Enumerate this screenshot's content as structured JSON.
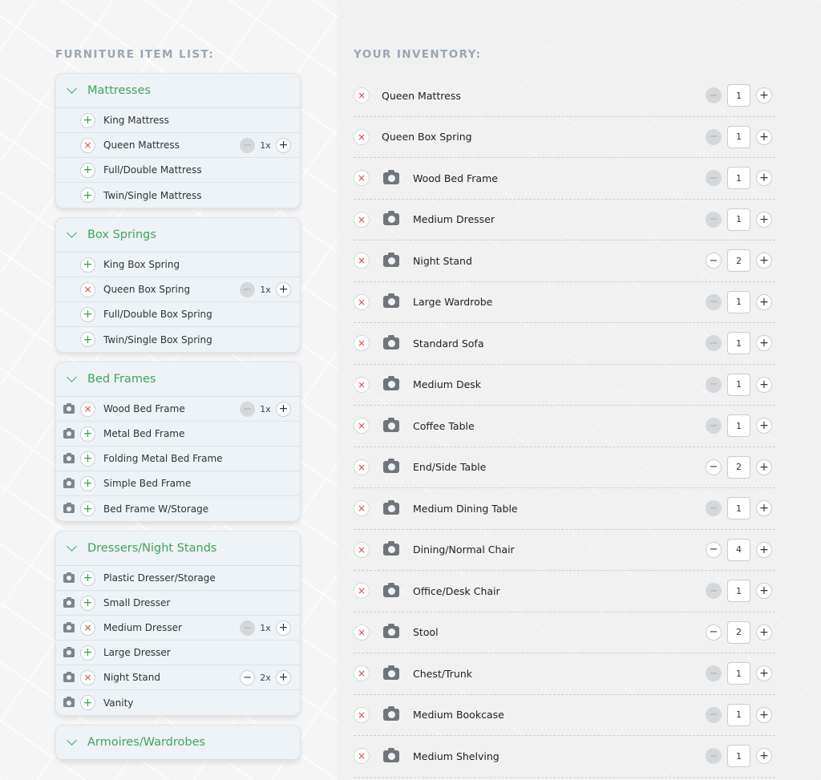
{
  "furniture_list": {
    "title": "FURNITURE ITEM LIST:",
    "categories": [
      {
        "name": "Mattresses",
        "items": [
          {
            "label": "King Mattress",
            "camera": false,
            "added": false
          },
          {
            "label": "Queen Mattress",
            "camera": false,
            "added": true,
            "qty": "1x",
            "minus_active": false
          },
          {
            "label": "Full/Double Mattress",
            "camera": false,
            "added": false
          },
          {
            "label": "Twin/Single Mattress",
            "camera": false,
            "added": false
          }
        ]
      },
      {
        "name": "Box Springs",
        "items": [
          {
            "label": "King Box Spring",
            "camera": false,
            "added": false
          },
          {
            "label": "Queen Box Spring",
            "camera": false,
            "added": true,
            "qty": "1x",
            "minus_active": false
          },
          {
            "label": "Full/Double Box Spring",
            "camera": false,
            "added": false
          },
          {
            "label": "Twin/Single Box Spring",
            "camera": false,
            "added": false
          }
        ]
      },
      {
        "name": "Bed Frames",
        "items": [
          {
            "label": "Wood Bed Frame",
            "camera": true,
            "added": true,
            "qty": "1x",
            "minus_active": false
          },
          {
            "label": "Metal Bed Frame",
            "camera": true,
            "added": false
          },
          {
            "label": "Folding Metal Bed Frame",
            "camera": true,
            "added": false
          },
          {
            "label": "Simple Bed Frame",
            "camera": true,
            "added": false
          },
          {
            "label": "Bed Frame W/Storage",
            "camera": true,
            "added": false
          }
        ]
      },
      {
        "name": "Dressers/Night Stands",
        "items": [
          {
            "label": "Plastic Dresser/Storage",
            "camera": true,
            "added": false
          },
          {
            "label": "Small Dresser",
            "camera": true,
            "added": false
          },
          {
            "label": "Medium Dresser",
            "camera": true,
            "added": true,
            "qty": "1x",
            "minus_active": false
          },
          {
            "label": "Large Dresser",
            "camera": true,
            "added": false
          },
          {
            "label": "Night Stand",
            "camera": true,
            "added": true,
            "qty": "2x",
            "minus_active": true
          },
          {
            "label": "Vanity",
            "camera": true,
            "added": false
          }
        ]
      },
      {
        "name": "Armoires/Wardrobes",
        "items": []
      }
    ]
  },
  "inventory": {
    "title": "YOUR INVENTORY:",
    "items": [
      {
        "label": "Queen Mattress",
        "camera": false,
        "qty": "1",
        "minus_active": false
      },
      {
        "label": "Queen Box Spring",
        "camera": false,
        "qty": "1",
        "minus_active": false
      },
      {
        "label": "Wood Bed Frame",
        "camera": true,
        "qty": "1",
        "minus_active": false
      },
      {
        "label": "Medium Dresser",
        "camera": true,
        "qty": "1",
        "minus_active": false
      },
      {
        "label": "Night Stand",
        "camera": true,
        "qty": "2",
        "minus_active": true
      },
      {
        "label": "Large Wardrobe",
        "camera": true,
        "qty": "1",
        "minus_active": false
      },
      {
        "label": "Standard Sofa",
        "camera": true,
        "qty": "1",
        "minus_active": false
      },
      {
        "label": "Medium Desk",
        "camera": true,
        "qty": "1",
        "minus_active": false
      },
      {
        "label": "Coffee Table",
        "camera": true,
        "qty": "1",
        "minus_active": false
      },
      {
        "label": "End/Side Table",
        "camera": true,
        "qty": "2",
        "minus_active": true
      },
      {
        "label": "Medium Dining Table",
        "camera": true,
        "qty": "1",
        "minus_active": false
      },
      {
        "label": "Dining/Normal Chair",
        "camera": true,
        "qty": "4",
        "minus_active": true
      },
      {
        "label": "Office/Desk Chair",
        "camera": true,
        "qty": "1",
        "minus_active": false
      },
      {
        "label": "Stool",
        "camera": true,
        "qty": "2",
        "minus_active": true
      },
      {
        "label": "Chest/Trunk",
        "camera": true,
        "qty": "1",
        "minus_active": false
      },
      {
        "label": "Medium Bookcase",
        "camera": true,
        "qty": "1",
        "minus_active": false
      },
      {
        "label": "Medium Shelving",
        "camera": true,
        "qty": "1",
        "minus_active": false
      }
    ]
  },
  "icons": {
    "add": "+",
    "remove": "×",
    "minus": "−",
    "chevron": "chevron-down-icon",
    "camera": "camera-icon"
  },
  "colors": {
    "accent_green": "#41a35d",
    "remove_red": "#d6433f",
    "section_title": "#9aa6b2"
  }
}
